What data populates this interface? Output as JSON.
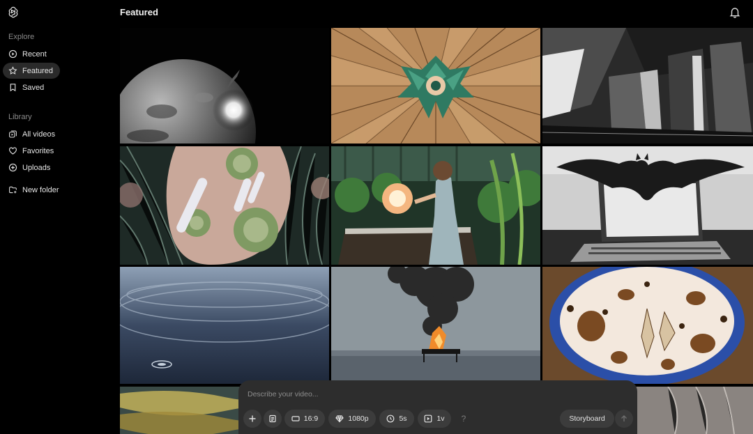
{
  "sidebar": {
    "explore_label": "Explore",
    "library_label": "Library",
    "explore_items": [
      {
        "label": "Recent",
        "icon": "play-circle-icon"
      },
      {
        "label": "Featured",
        "icon": "star-icon",
        "active": true
      },
      {
        "label": "Saved",
        "icon": "bookmark-icon"
      }
    ],
    "library_items": [
      {
        "label": "All videos",
        "icon": "videos-icon"
      },
      {
        "label": "Favorites",
        "icon": "heart-icon"
      },
      {
        "label": "Uploads",
        "icon": "plus-circle-icon"
      }
    ],
    "new_folder_label": "New folder"
  },
  "header": {
    "title": "Featured"
  },
  "gallery": {
    "tiles": [
      {
        "name": "tile-moon-planet"
      },
      {
        "name": "tile-origami-paper"
      },
      {
        "name": "tile-concrete-architecture"
      },
      {
        "name": "tile-pollen-macro"
      },
      {
        "name": "tile-greenhouse-girl"
      },
      {
        "name": "tile-bat-laptop"
      },
      {
        "name": "tile-water-ripple"
      },
      {
        "name": "tile-burning-piano"
      },
      {
        "name": "tile-coffee-cup"
      },
      {
        "name": "tile-golden-waves"
      },
      {
        "name": "tile-partial-dark"
      },
      {
        "name": "tile-fur-closeup"
      }
    ]
  },
  "composer": {
    "placeholder": "Describe your video...",
    "aspect_label": "16:9",
    "resolution_label": "1080p",
    "duration_label": "5s",
    "variations_label": "1v",
    "help_label": "?",
    "storyboard_label": "Storyboard"
  }
}
